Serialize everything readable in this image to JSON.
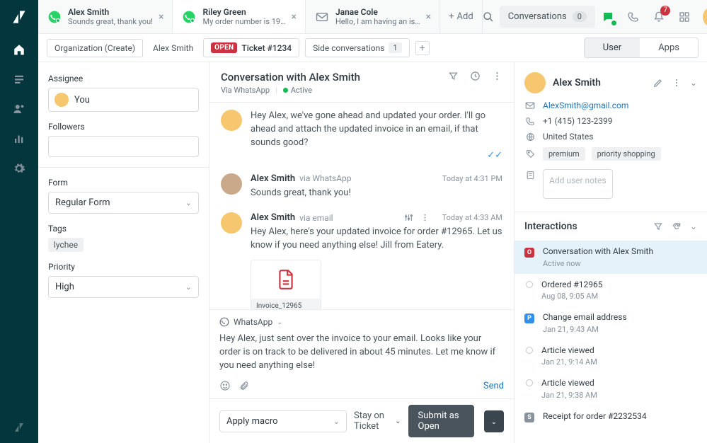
{
  "tabs": [
    {
      "title": "Alex Smith",
      "subtitle": "Sounds great, thank you!",
      "kind": "whatsapp",
      "active": false
    },
    {
      "title": "Riley Green",
      "subtitle": "My order number is 19…",
      "kind": "whatsapp",
      "active": true
    },
    {
      "title": "Janae Cole",
      "subtitle": "Hello, I am having an is…",
      "kind": "mail",
      "active": false
    }
  ],
  "addTabLabel": "Add",
  "convChip": {
    "label": "Conversations",
    "count": "0"
  },
  "bellCount": "7",
  "breadcrumbs": {
    "org": "Organization (Create)",
    "user": "Alex Smith",
    "openBadge": "OPEN",
    "ticket": "Ticket #1234",
    "side": {
      "label": "Side conversations",
      "count": "1"
    }
  },
  "segTabs": {
    "user": "User",
    "apps": "Apps"
  },
  "leftPane": {
    "assigneeLabel": "Assignee",
    "assigneeValue": "You",
    "followersLabel": "Followers",
    "formLabel": "Form",
    "formValue": "Regular Form",
    "tagsLabel": "Tags",
    "tag": "lychee",
    "priorityLabel": "Priority",
    "priorityValue": "High"
  },
  "conversation": {
    "title": "Conversation with Alex Smith",
    "viaLabel": "Via WhatsApp",
    "statusLabel": "Active",
    "messages": [
      {
        "author": "",
        "via": "",
        "time": "",
        "text": "Hey Alex, we've gone ahead and updated your order. I'll go ahead and attach the updated invoice in an email, if that sounds good?",
        "avatar": "yellow",
        "showCheck": true
      },
      {
        "author": "Alex Smith",
        "via": "via WhatsApp",
        "time": "Today at 4:31 PM",
        "text": "Sounds great, thank you!",
        "avatar": "man"
      },
      {
        "author": "Alex Smith",
        "via": "via email",
        "time": "Today at 4:33 AM",
        "text": "Hey Alex, here's your updated invoice for order #12965. Let us know if you need anything else! Jill from Eatery.",
        "avatar": "yellow",
        "showTools": true,
        "attachment": {
          "name": "Invoice_12965",
          "type": "PDF"
        }
      }
    ],
    "composer": {
      "channel": "WhatsApp",
      "text": "Hey Alex, just sent over the invoice to your email. Looks like your order is on track to be delivered in about 45 minutes. Let me know if you need anything else!",
      "sendLabel": "Send"
    },
    "macroLabel": "Apply macro",
    "stayLabel": "Stay on Ticket",
    "submitLabel": "Submit as Open"
  },
  "customer": {
    "name": "Alex Smith",
    "email": "AlexSmith@gmail.com",
    "phone": "+1 (415) 123-2399",
    "location": "United States",
    "tags": [
      "premium",
      "priority shopping"
    ],
    "notesPlaceholder": "Add user notes"
  },
  "interactions": {
    "title": "Interactions",
    "items": [
      {
        "mark": "o",
        "title": "Conversation with Alex Smith",
        "sub": "Active now",
        "active": true
      },
      {
        "mark": "circle",
        "title": "Ordered #12965",
        "sub": "Aug 08, 9:05 AM"
      },
      {
        "mark": "p",
        "title": "Change email address",
        "sub": "Jan 21, 9:43 AM"
      },
      {
        "mark": "circle",
        "title": "Article viewed",
        "sub": "Jan 21, 9:14 AM"
      },
      {
        "mark": "circle",
        "title": "Article viewed",
        "sub": "Jan 21, 9:38 AM"
      },
      {
        "mark": "s",
        "title": "Receipt for order #2232534",
        "sub": ""
      }
    ]
  }
}
